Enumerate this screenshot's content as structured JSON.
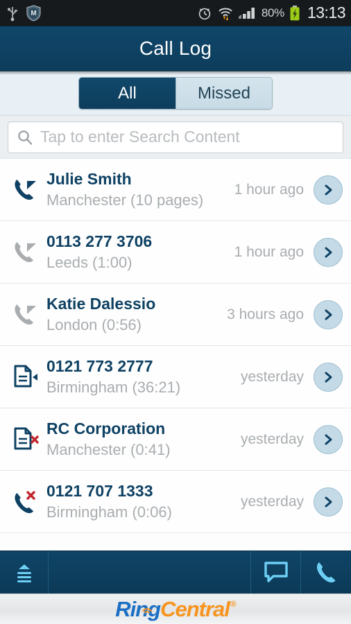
{
  "statusbar": {
    "icons_left": [
      "usb-icon",
      "mcafee-shield-icon"
    ],
    "icons_right": [
      "alarm-clock-icon",
      "wifi-transfer-icon",
      "signal-bars-icon",
      "battery-charging-icon"
    ],
    "battery_percent": "80%",
    "clock": "13:13"
  },
  "header": {
    "title": "Call Log"
  },
  "tabs": {
    "items": [
      {
        "label": "All",
        "active": true
      },
      {
        "label": "Missed",
        "active": false
      }
    ]
  },
  "search": {
    "icon": "search-icon",
    "value": "",
    "placeholder": "Tap to enter Search Content"
  },
  "call_log": {
    "rows": [
      {
        "icon": "phone-outgoing-icon",
        "icon_color": "#0e4163",
        "badge": "none",
        "title": "Julie Smith",
        "subtitle": "Manchester (10 pages)",
        "time": "1 hour ago",
        "chevron": "chevron-right-icon"
      },
      {
        "icon": "phone-incoming-icon",
        "icon_color": "#a9adb0",
        "badge": "none",
        "title": "0113 277 3706",
        "subtitle": "Leeds (1:00)",
        "time": "1 hour ago",
        "chevron": "chevron-right-icon"
      },
      {
        "icon": "phone-incoming-icon",
        "icon_color": "#a9adb0",
        "badge": "none",
        "title": "Katie Dalessio",
        "subtitle": "London (0:56)",
        "time": "3 hours ago",
        "chevron": "chevron-right-icon"
      },
      {
        "icon": "fax-received-icon",
        "icon_color": "#0e4163",
        "badge": "none",
        "title": "0121 773 2777",
        "subtitle": "Birmingham (36:21)",
        "time": "yesterday",
        "chevron": "chevron-right-icon"
      },
      {
        "icon": "fax-failed-icon",
        "icon_color": "#0e4163",
        "badge": "red-x",
        "title": "RC Corporation",
        "subtitle": "Manchester (0:41)",
        "time": "yesterday",
        "chevron": "chevron-right-icon"
      },
      {
        "icon": "phone-missed-icon",
        "icon_color": "#0e4163",
        "badge": "red-x",
        "title": "0121 707 1333",
        "subtitle": "Birmingham (0:06)",
        "time": "yesterday",
        "chevron": "chevron-right-icon"
      }
    ]
  },
  "toolbar": {
    "menu_icon": "menu-eject-icon",
    "message_icon": "message-bubble-icon",
    "call_icon": "phone-handset-icon"
  },
  "brand": {
    "part1": "Ring",
    "part2": "Central",
    "trademark": "®",
    "color1": "#1b6fc4",
    "color2": "#f7941e"
  },
  "theme": {
    "navy": "#0e4163",
    "accent_light_blue": "#6ecff6",
    "chip_blue": "#c5dae7",
    "muted_gray": "#a9adb0"
  }
}
